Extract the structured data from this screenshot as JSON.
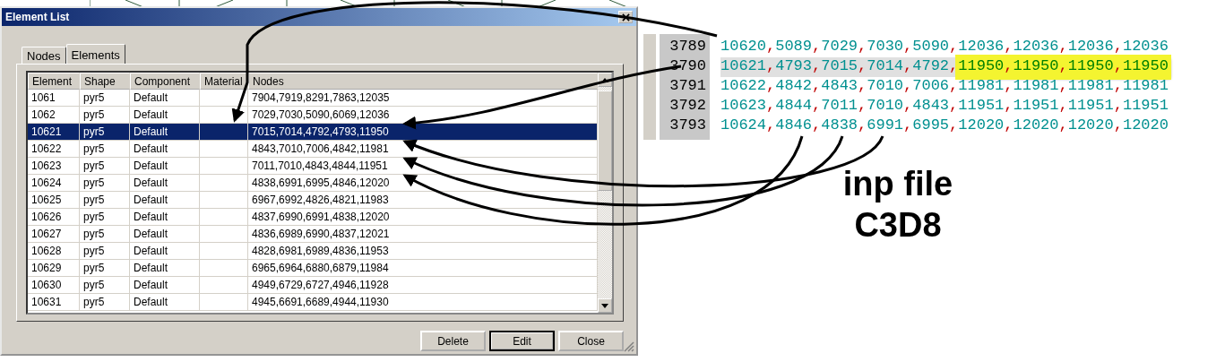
{
  "dialog": {
    "title": "Element List",
    "tabs": [
      {
        "label": "Nodes",
        "selected": false
      },
      {
        "label": "Elements",
        "selected": true
      }
    ],
    "table": {
      "columns": [
        "Element",
        "Shape",
        "Component",
        "Material",
        "Nodes"
      ],
      "rows": [
        {
          "cells": [
            "1061",
            "pyr5",
            "Default",
            "",
            "7904,7919,8291,7863,12035"
          ],
          "selected": false
        },
        {
          "cells": [
            "1062",
            "pyr5",
            "Default",
            "",
            "7029,7030,5090,6069,12036"
          ],
          "selected": false
        },
        {
          "cells": [
            "10621",
            "pyr5",
            "Default",
            "",
            "7015,7014,4792,4793,11950"
          ],
          "selected": true
        },
        {
          "cells": [
            "10622",
            "pyr5",
            "Default",
            "",
            "4843,7010,7006,4842,11981"
          ],
          "selected": false
        },
        {
          "cells": [
            "10623",
            "pyr5",
            "Default",
            "",
            "7011,7010,4843,4844,11951"
          ],
          "selected": false
        },
        {
          "cells": [
            "10624",
            "pyr5",
            "Default",
            "",
            "4838,6991,6995,4846,12020"
          ],
          "selected": false
        },
        {
          "cells": [
            "10625",
            "pyr5",
            "Default",
            "",
            "6967,6992,4826,4821,11983"
          ],
          "selected": false
        },
        {
          "cells": [
            "10626",
            "pyr5",
            "Default",
            "",
            "4837,6990,6991,4838,12020"
          ],
          "selected": false
        },
        {
          "cells": [
            "10627",
            "pyr5",
            "Default",
            "",
            "4836,6989,6990,4837,12021"
          ],
          "selected": false
        },
        {
          "cells": [
            "10628",
            "pyr5",
            "Default",
            "",
            "4828,6981,6989,4836,11953"
          ],
          "selected": false
        },
        {
          "cells": [
            "10629",
            "pyr5",
            "Default",
            "",
            "6965,6964,6880,6879,11984"
          ],
          "selected": false
        },
        {
          "cells": [
            "10630",
            "pyr5",
            "Default",
            "",
            "4949,6729,6727,4946,11928"
          ],
          "selected": false
        },
        {
          "cells": [
            "10631",
            "pyr5",
            "Default",
            "",
            "4945,6691,6689,4944,11930"
          ],
          "selected": false
        }
      ]
    },
    "buttons": [
      {
        "label": "Delete",
        "default": false
      },
      {
        "label": "Edit",
        "default": true
      },
      {
        "label": "Close",
        "default": false
      }
    ]
  },
  "editor": {
    "lines": [
      {
        "number": "3789",
        "text": "10620,5089,7029,7030,5090,12036,12036,12036,12036",
        "selected": false
      },
      {
        "number": "3790",
        "text": "10621,4793,7015,7014,4792,",
        "highlighted": "11950,11950,11950,11950",
        "selected": true
      },
      {
        "number": "3791",
        "text": "10622,4842,4843,7010,7006,11981,11981,11981,11981",
        "selected": false
      },
      {
        "number": "3792",
        "text": "10623,4844,7011,7010,4843,11951,11951,11951,11951",
        "selected": false
      },
      {
        "number": "3793",
        "text": "10624,4846,4838,6991,6995,12020,12020,12020,12020",
        "selected": false
      }
    ]
  },
  "annotation": [
    "inp file",
    "C3D8"
  ]
}
